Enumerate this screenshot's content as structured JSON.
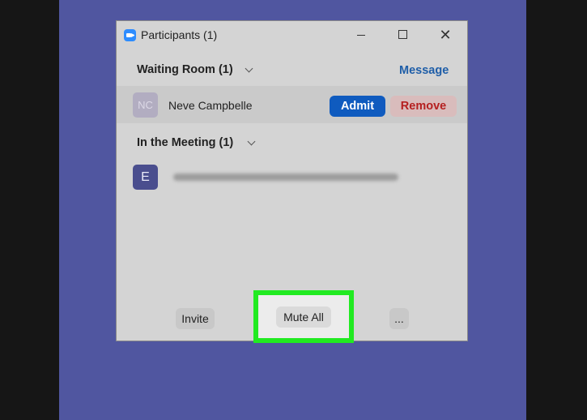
{
  "window": {
    "title": "Participants (1)",
    "close_glyph": "✕"
  },
  "waiting_room": {
    "heading": "Waiting Room (1)",
    "message_label": "Message",
    "participant": {
      "initials": "NC",
      "name": "Neve Campbelle",
      "admit_label": "Admit",
      "remove_label": "Remove"
    }
  },
  "meeting": {
    "heading": "In the Meeting (1)",
    "participant": {
      "initial": "E"
    }
  },
  "footer": {
    "invite_label": "Invite",
    "mute_all_label": "Mute All",
    "more_label": "..."
  },
  "colors": {
    "background": "#5056a0",
    "panel": "#d4d4d4",
    "admit": "#0f5bbf",
    "remove_text": "#b52020",
    "highlight": "#21ea21",
    "message": "#1f5ea8"
  }
}
